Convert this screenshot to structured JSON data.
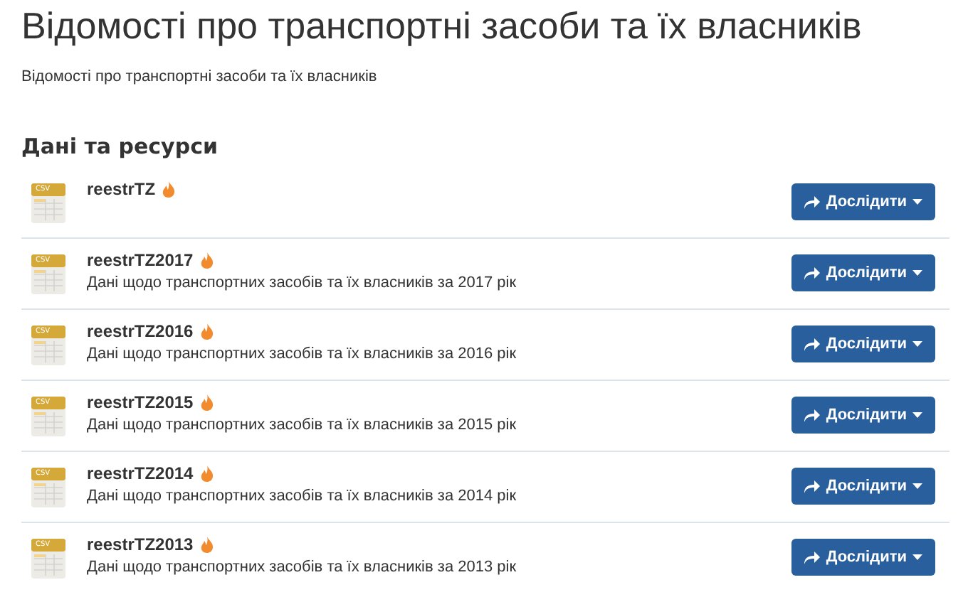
{
  "title": "Відомості про транспортні засоби та їх власників",
  "description": "Відомості про транспортні засоби та їх власників",
  "resources_heading": "Дані та ресурси",
  "resources": [
    {
      "format": "CSV",
      "name": "reestrTZ",
      "popular": true,
      "button": "Дослідити"
    },
    {
      "format": "CSV",
      "name": "reestrTZ2017",
      "popular": true,
      "description": "Дані щодо транспортних засобів та їх власників за 2017 рік",
      "button": "Дослідити"
    },
    {
      "format": "CSV",
      "name": "reestrTZ2016",
      "popular": true,
      "description": "Дані щодо транспортних засобів та їх власників за 2016 рік",
      "button": "Дослідити"
    },
    {
      "format": "CSV",
      "name": "reestrTZ2015",
      "popular": true,
      "description": "Дані щодо транспортних засобів та їх власників за 2015 рік",
      "button": "Дослідити"
    },
    {
      "format": "CSV",
      "name": "reestrTZ2014",
      "popular": true,
      "description": "Дані щодо транспортних засобів та їх власників за 2014 рік",
      "button": "Дослідити"
    },
    {
      "format": "CSV",
      "name": "reestrTZ2013",
      "popular": true,
      "description": "Дані щодо транспортних засобів та їх власників за 2013 рік",
      "button": "Дослідити"
    }
  ]
}
